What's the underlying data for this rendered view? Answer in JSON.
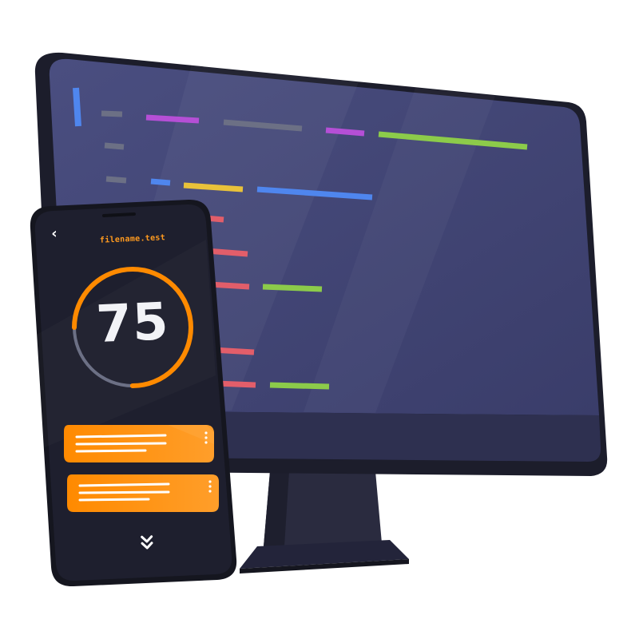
{
  "phone": {
    "back_glyph": "‹",
    "filename": "filename.test",
    "score": "75",
    "score_fraction": 0.75,
    "expand_glyph": "⌄⌄"
  },
  "icons": {
    "back": "chevron-left-icon",
    "more": "vertical-dots-icon",
    "expand": "double-chevron-down-icon"
  },
  "colors": {
    "monitor_screen": "#3b3e6b",
    "phone_body": "#1c1d2b",
    "accent_orange": "#ff8a00",
    "code_purple": "#b54fd6",
    "code_gray": "#6c7085",
    "code_green": "#8ccb4a",
    "code_blue": "#4f86ee",
    "code_yellow": "#e9c23a",
    "code_red": "#e25e6a"
  }
}
